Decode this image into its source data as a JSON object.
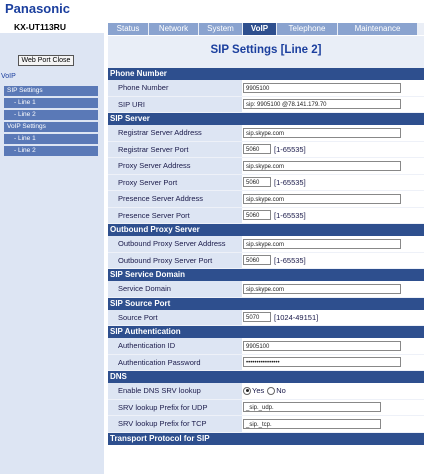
{
  "brand": "Panasonic",
  "model": "KX-UT113RU",
  "sidebar": {
    "web_port_close": "Web Port Close",
    "voip_link": "VoIP",
    "items": [
      {
        "label": "SIP Settings",
        "sub": false
      },
      {
        "label": "- Line 1",
        "sub": true
      },
      {
        "label": "- Line 2",
        "sub": true
      },
      {
        "label": "VoIP Settings",
        "sub": false
      },
      {
        "label": "- Line 1",
        "sub": true
      },
      {
        "label": "- Line 2",
        "sub": true
      }
    ]
  },
  "tabs": [
    "Status",
    "Network",
    "System",
    "VoIP",
    "Telephone",
    "Maintenance"
  ],
  "active_tab": "VoIP",
  "page_title": "SIP Settings [Line 2]",
  "sections": {
    "phone_number": {
      "title": "Phone Number",
      "phone_number_label": "Phone Number",
      "phone_number_value": "9905100",
      "sip_uri_label": "SIP URI",
      "sip_uri_value": "sip: 9905100           @78.141.179.70"
    },
    "sip_server": {
      "title": "SIP Server",
      "registrar_address_label": "Registrar Server Address",
      "registrar_address_value": "sip.skype.com",
      "registrar_port_label": "Registrar Server Port",
      "registrar_port_value": "5060",
      "registrar_port_range": "[1-65535]",
      "proxy_address_label": "Proxy Server Address",
      "proxy_address_value": "sip.skype.com",
      "proxy_port_label": "Proxy Server Port",
      "proxy_port_value": "5060",
      "proxy_port_range": "[1-65535]",
      "presence_address_label": "Presence Server Address",
      "presence_address_value": "sip.skype.com",
      "presence_port_label": "Presence Server Port",
      "presence_port_value": "5060",
      "presence_port_range": "[1-65535]"
    },
    "outbound_proxy": {
      "title": "Outbound Proxy Server",
      "address_label": "Outbound Proxy Server Address",
      "address_value": "sip.skype.com",
      "port_label": "Outbound Proxy Server Port",
      "port_value": "5060",
      "port_range": "[1-65535]"
    },
    "service_domain": {
      "title": "SIP Service Domain",
      "label": "Service Domain",
      "value": "sip.skype.com"
    },
    "source_port": {
      "title": "SIP Source Port",
      "label": "Source Port",
      "value": "5070",
      "range": "[1024-49151]"
    },
    "authentication": {
      "title": "SIP Authentication",
      "id_label": "Authentication ID",
      "id_value": "9905100",
      "password_label": "Authentication Password",
      "password_value": "••••••••••••••••"
    },
    "dns": {
      "title": "DNS",
      "srv_lookup_label": "Enable DNS SRV lookup",
      "srv_yes": "Yes",
      "srv_no": "No",
      "srv_selected": "Yes",
      "udp_prefix_label": "SRV lookup Prefix for UDP",
      "udp_prefix_value": "_sip._udp.",
      "tcp_prefix_label": "SRV lookup Prefix for TCP",
      "tcp_prefix_value": "_sip._tcp."
    },
    "transport": {
      "title": "Transport Protocol for SIP"
    }
  }
}
